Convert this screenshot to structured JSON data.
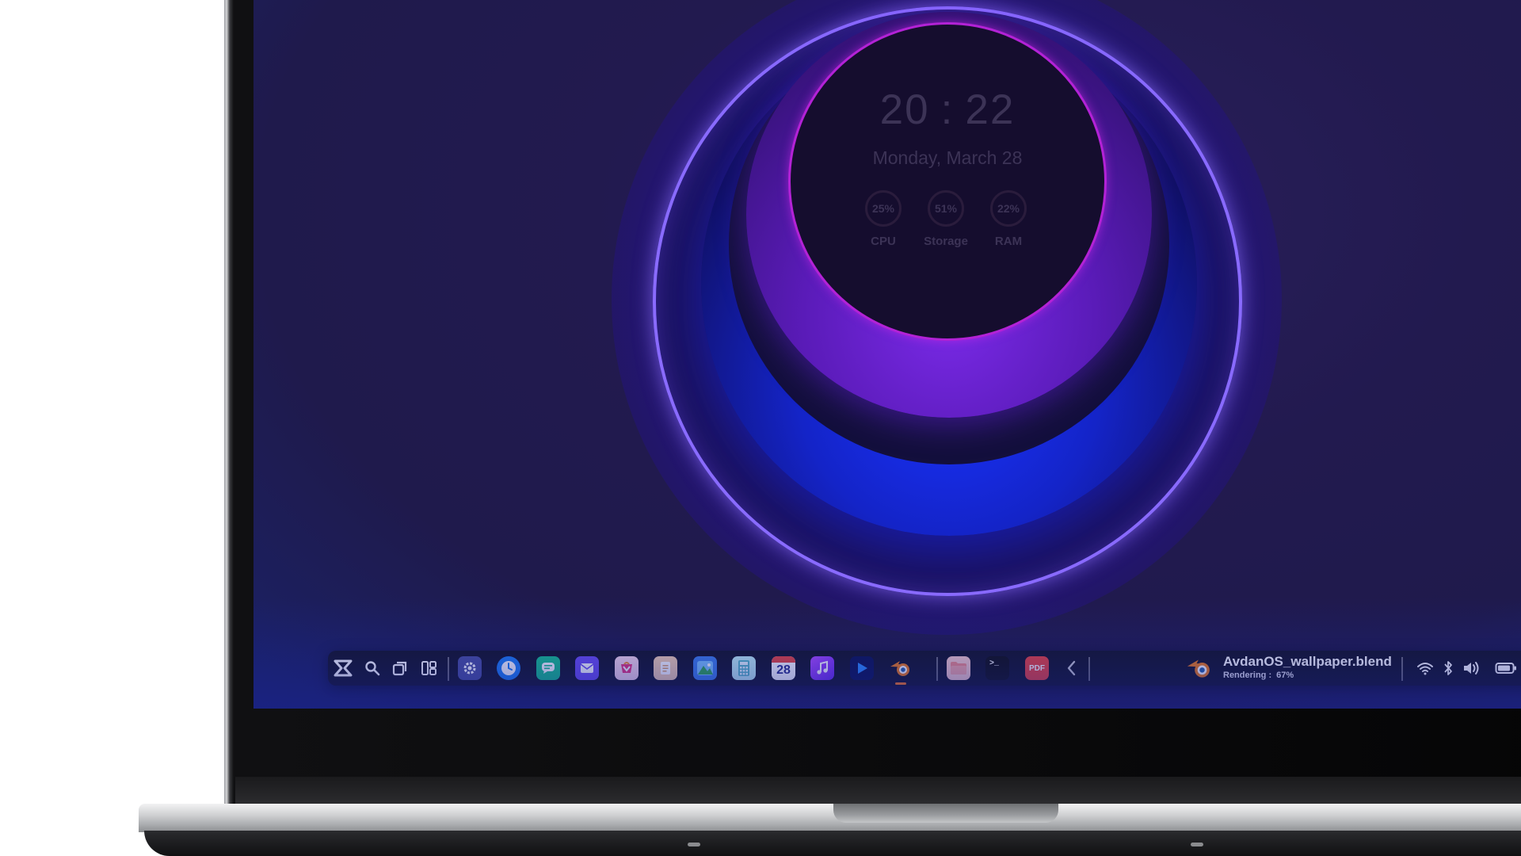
{
  "clock": {
    "hours": "20",
    "separator": ":",
    "minutes": "22",
    "date": "Monday, March 28"
  },
  "gauges": [
    {
      "value": "25%",
      "label": "CPU"
    },
    {
      "value": "51%",
      "label": "Storage"
    },
    {
      "value": "22%",
      "label": "RAM"
    }
  ],
  "taskbar": {
    "calendar_day": "28",
    "pdf_label": "PDF",
    "terminal_glyph": ">_",
    "active_task": {
      "title": "AvdanOS_wallpaper.blend",
      "status_label": "Rendering :",
      "progress": "67%"
    },
    "icons": {
      "launcher": "avdan-logo-icon",
      "search": "search-icon",
      "window_switcher": "window-switcher-icon",
      "workspaces": "workspaces-icon",
      "settings": "settings-icon",
      "clock": "clock-icon",
      "messages": "messages-icon",
      "mail": "mail-icon",
      "store": "store-icon",
      "notes": "notes-icon",
      "photos": "photos-icon",
      "calculator": "calculator-icon",
      "calendar": "calendar-icon",
      "music": "music-icon",
      "video": "video-player-icon",
      "blender": "blender-icon",
      "files": "files-icon",
      "terminal": "terminal-icon",
      "pdf": "pdf-icon",
      "collapse": "chevron-left-icon",
      "wifi": "wifi-icon",
      "bluetooth": "bluetooth-icon",
      "volume": "volume-icon",
      "battery": "battery-icon",
      "multitasking": "multitasking-icon"
    }
  },
  "colors": {
    "accent_ring": "#8b6cff",
    "face_border": "#b322d6",
    "taskbar_bg": "#131426"
  }
}
